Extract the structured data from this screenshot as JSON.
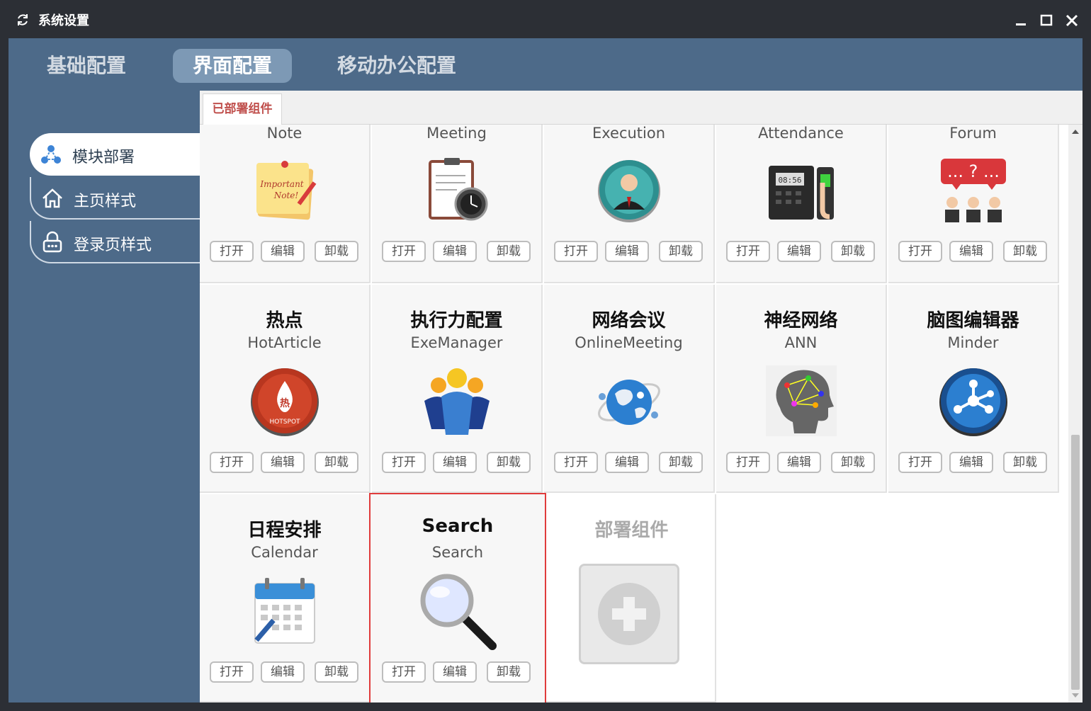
{
  "window": {
    "title": "系统设置"
  },
  "top_tabs": [
    {
      "label": "基础配置",
      "active": false
    },
    {
      "label": "界面配置",
      "active": true
    },
    {
      "label": "移动办公配置",
      "active": false
    }
  ],
  "nav": [
    {
      "label": "模块部署",
      "icon": "module-network-icon",
      "active": true
    },
    {
      "label": "主页样式",
      "icon": "home-icon",
      "active": false
    },
    {
      "label": "登录页样式",
      "icon": "lock-icon",
      "active": false
    }
  ],
  "panel": {
    "tab_label": "已部署组件"
  },
  "button_labels": {
    "open": "打开",
    "edit": "编辑",
    "uninstall": "卸载"
  },
  "components": [
    {
      "cn": "",
      "en": "Note",
      "icon": "sticky-note-icon"
    },
    {
      "cn": "",
      "en": "Meeting",
      "icon": "meeting-clipboard-icon"
    },
    {
      "cn": "",
      "en": "Execution",
      "icon": "executive-icon"
    },
    {
      "cn": "",
      "en": "Attendance",
      "icon": "fingerprint-device-icon"
    },
    {
      "cn": "",
      "en": "Forum",
      "icon": "forum-people-icon"
    },
    {
      "cn": "热点",
      "en": "HotArticle",
      "icon": "hotspot-icon"
    },
    {
      "cn": "执行力配置",
      "en": "ExeManager",
      "icon": "team-icon"
    },
    {
      "cn": "网络会议",
      "en": "OnlineMeeting",
      "icon": "globe-network-icon"
    },
    {
      "cn": "神经网络",
      "en": "ANN",
      "icon": "brain-icon"
    },
    {
      "cn": "脑图编辑器",
      "en": "Minder",
      "icon": "mindmap-icon"
    },
    {
      "cn": "日程安排",
      "en": "Calendar",
      "icon": "calendar-icon"
    },
    {
      "cn": "Search",
      "en": "Search",
      "icon": "magnifier-icon",
      "selected": true
    }
  ],
  "deploy": {
    "label": "部署组件"
  },
  "device_time": "08:56",
  "colors": {
    "accent_red": "#e03c3c",
    "panel_tab_text": "#c0504d",
    "sidebar_bg": "#4d6a89",
    "active_tab_bg": "#7d99b5"
  }
}
